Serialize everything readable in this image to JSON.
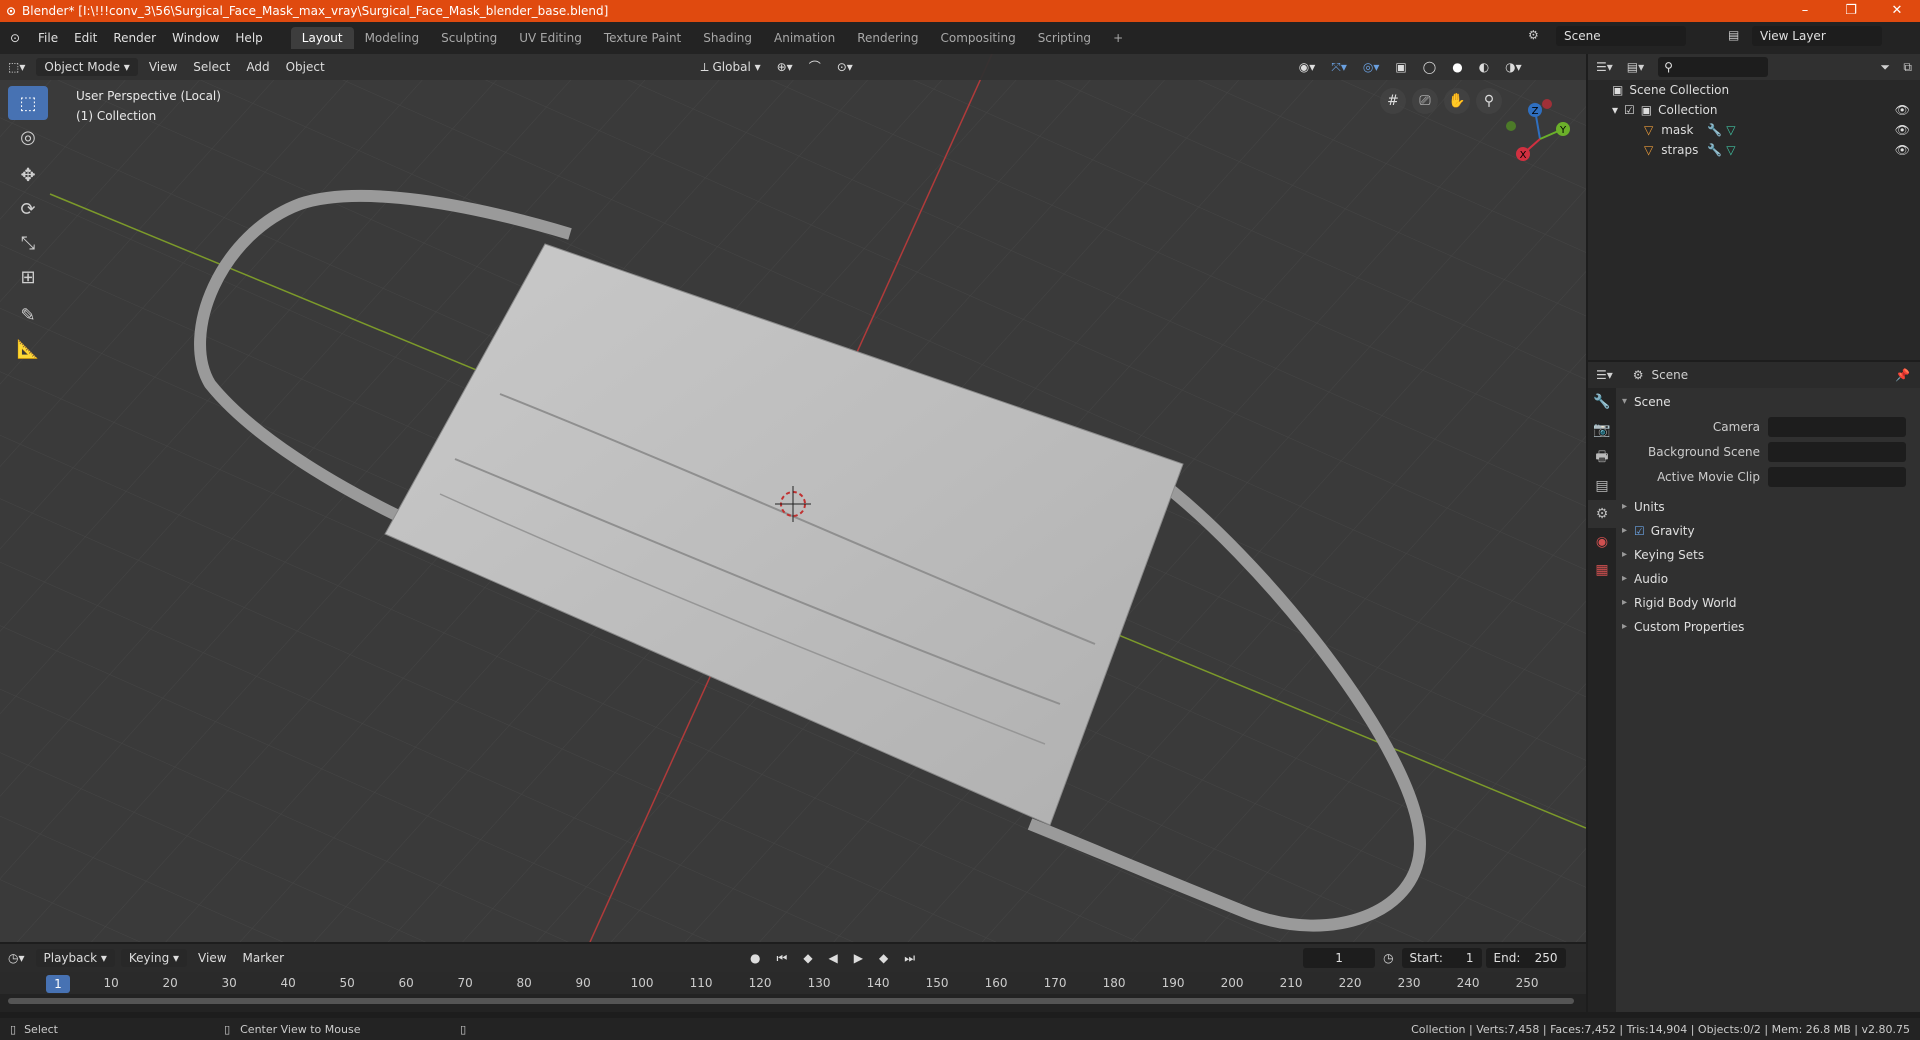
{
  "window": {
    "title": "Blender* [I:\\!!!conv_3\\56\\Surgical_Face_Mask_max_vray\\Surgical_Face_Mask_blender_base.blend]",
    "minimize": "–",
    "maximize": "❐",
    "close": "✕"
  },
  "menus": [
    "File",
    "Edit",
    "Render",
    "Window",
    "Help"
  ],
  "workspaces": [
    "Layout",
    "Modeling",
    "Sculpting",
    "UV Editing",
    "Texture Paint",
    "Shading",
    "Animation",
    "Rendering",
    "Compositing",
    "Scripting"
  ],
  "add_workspace": "+",
  "scene_selector": "Scene",
  "view_layer_selector": "View Layer",
  "viewport_header": {
    "mode": "Object Mode",
    "menus": [
      "View",
      "Select",
      "Add",
      "Object"
    ],
    "orientation": "Global"
  },
  "viewport_info": {
    "line1": "User Perspective (Local)",
    "line2": "(1) Collection"
  },
  "gizmo": {
    "x": "X",
    "y": "Y",
    "z": "Z"
  },
  "outliner": {
    "root": "Scene Collection",
    "collection": "Collection",
    "objects": [
      "mask",
      "straps"
    ]
  },
  "properties": {
    "context": "Scene",
    "panel_scene": "Scene",
    "camera_label": "Camera",
    "background_scene_label": "Background Scene",
    "active_movie_clip_label": "Active Movie Clip",
    "panels": [
      "Units",
      "Gravity",
      "Keying Sets",
      "Audio",
      "Rigid Body World",
      "Custom Properties"
    ]
  },
  "timeline": {
    "menus": [
      "Playback",
      "Keying",
      "View",
      "Marker"
    ],
    "current_frame": "1",
    "start_label": "Start:",
    "start": "1",
    "end_label": "End:",
    "end": "250",
    "ruler": [
      "1",
      "10",
      "20",
      "30",
      "40",
      "50",
      "60",
      "70",
      "80",
      "90",
      "100",
      "110",
      "120",
      "130",
      "140",
      "150",
      "160",
      "170",
      "180",
      "190",
      "200",
      "210",
      "220",
      "230",
      "240",
      "250"
    ]
  },
  "status": {
    "select": "Select",
    "center_view": "Center View to Mouse",
    "stats": "Collection | Verts:7,458 | Faces:7,452 | Tris:14,904 | Objects:0/2 | Mem: 26.8 MB | v2.80.75"
  }
}
